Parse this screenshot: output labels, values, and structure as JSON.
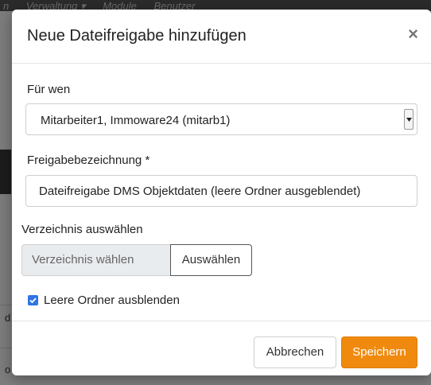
{
  "background": {
    "nav_items": [
      "n",
      "Verwaltung ▾",
      "Module",
      "Benutzer"
    ],
    "side_chars": [
      "d",
      "o"
    ]
  },
  "dialog": {
    "title": "Neue Dateifreigabe hinzufügen",
    "close_glyph": "×",
    "for_whom": {
      "label": "Für wen",
      "selected": "Mitarbeiter1, Immoware24 (mitarb1)"
    },
    "share_name": {
      "label": "Freigabebezeichnung *",
      "value": "Dateifreigabe DMS Objektdaten (leere Ordner ausgeblendet)"
    },
    "directory": {
      "label": "Verzeichnis auswählen",
      "placeholder": "Verzeichnis wählen",
      "button": "Auswählen"
    },
    "hide_empty": {
      "label": "Leere Ordner ausblenden",
      "checked": true
    },
    "buttons": {
      "cancel": "Abbrechen",
      "save": "Speichern"
    }
  },
  "colors": {
    "primary": "#f08a0e",
    "checkbox": "#2f74e5",
    "readonly_bg": "#e9ecef"
  }
}
